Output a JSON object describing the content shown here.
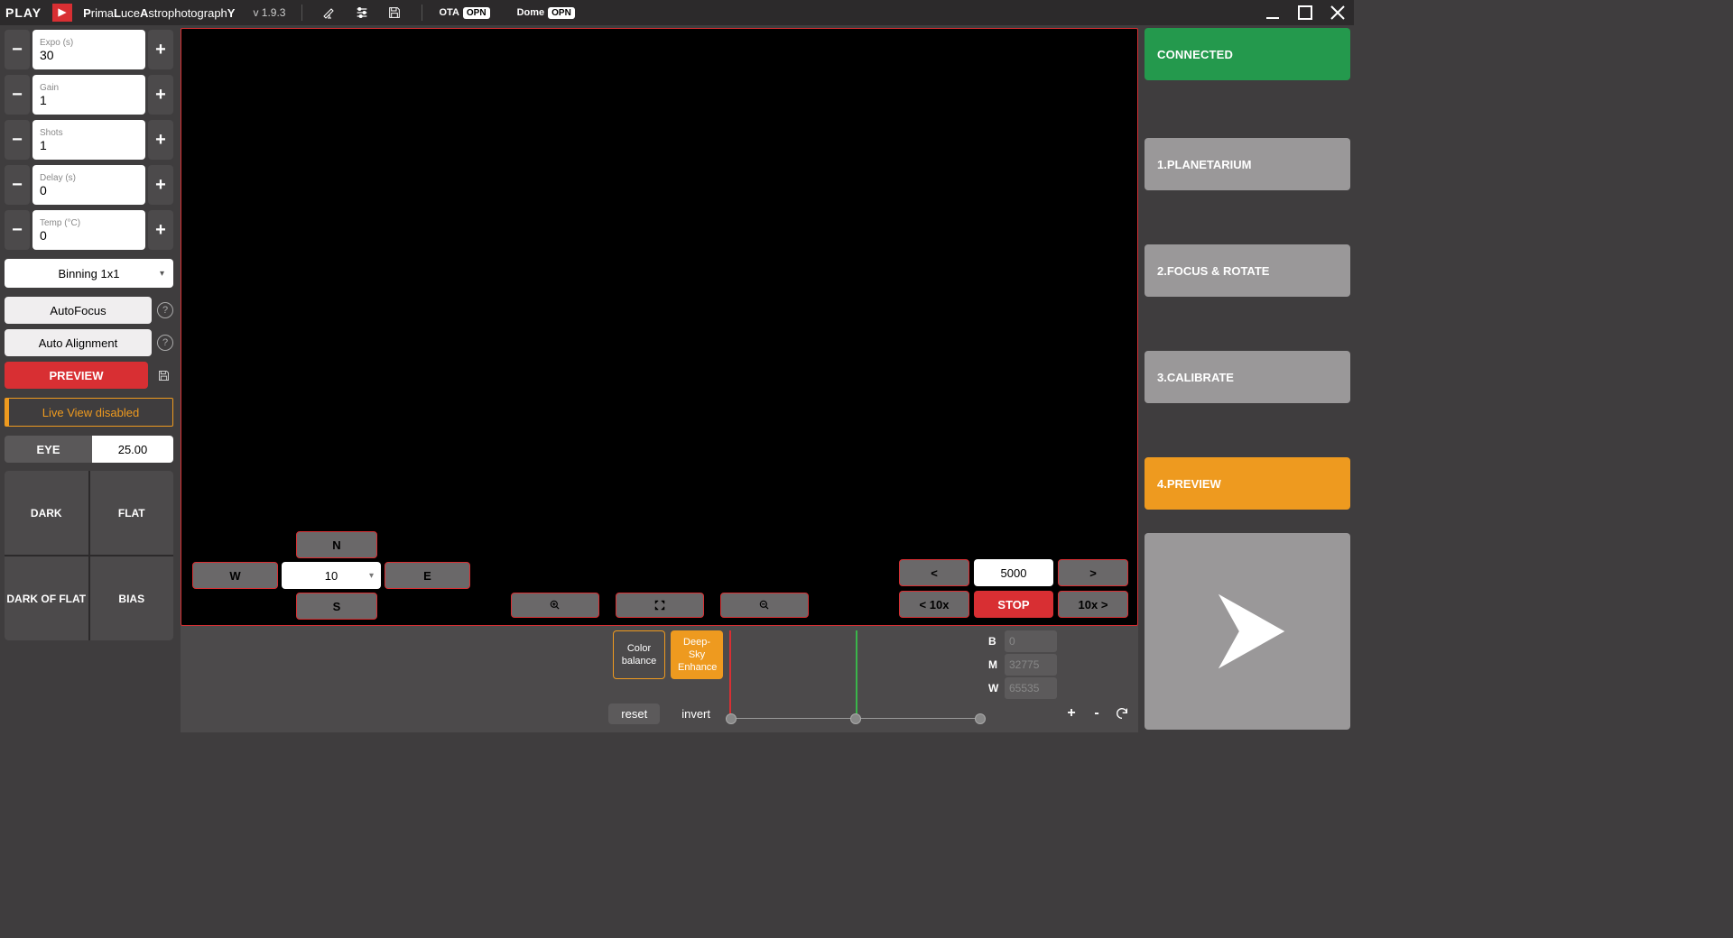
{
  "topbar": {
    "play": "PLAY",
    "brand_parts": [
      "P",
      "rima",
      "L",
      "uce",
      "A",
      "strophotograph",
      "Y"
    ],
    "version": "v 1.9.3",
    "ota_label": "OTA",
    "ota_status": "OPN",
    "dome_label": "Dome",
    "dome_status": "OPN"
  },
  "left": {
    "expo_label": "Expo (s)",
    "expo_value": "30",
    "gain_label": "Gain",
    "gain_value": "1",
    "shots_label": "Shots",
    "shots_value": "1",
    "delay_label": "Delay (s)",
    "delay_value": "0",
    "temp_label": "Temp (°C)",
    "temp_value": "0",
    "binning": "Binning 1x1",
    "autofocus": "AutoFocus",
    "autoalign": "Auto Alignment",
    "preview": "PREVIEW",
    "liveview": "Live View disabled",
    "eye_label": "EYE",
    "eye_value": "25.00",
    "frames": [
      "DARK",
      "FLAT",
      "DARK OF FLAT",
      "BIAS"
    ]
  },
  "main": {
    "dir": {
      "N": "N",
      "S": "S",
      "E": "E",
      "W": "W",
      "speed": "10"
    },
    "nudge": {
      "lt": "<",
      "gt": ">",
      "lt10": "< 10x",
      "gt10": "10x >",
      "stop": "STOP",
      "value": "5000"
    }
  },
  "bottom": {
    "color_balance_l1": "Color",
    "color_balance_l2": "balance",
    "deep_sky_l1": "Deep-Sky",
    "deep_sky_l2": "Enhance",
    "reset": "reset",
    "invert": "invert",
    "B_label": "B",
    "B": "0",
    "M_label": "M",
    "M": "32775",
    "W_label": "W",
    "W": "65535",
    "plus": "+",
    "minus": "-"
  },
  "right": {
    "connected": "CONNECTED",
    "nav1": "1.PLANETARIUM",
    "nav2": "2.FOCUS & ROTATE",
    "nav3": "3.CALIBRATE",
    "nav4": "4.PREVIEW"
  }
}
